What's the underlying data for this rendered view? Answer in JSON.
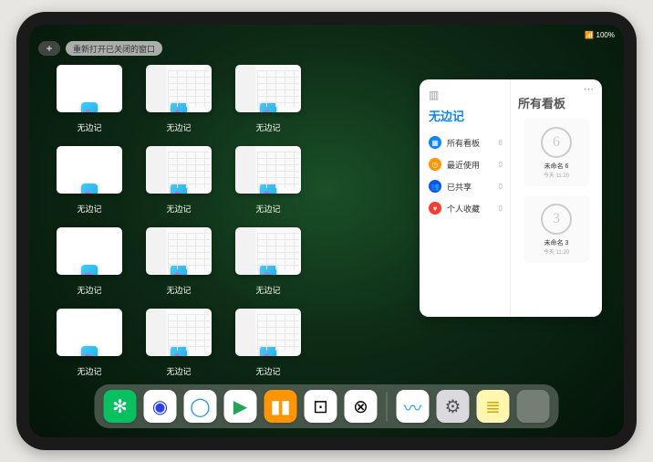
{
  "status": {
    "time": "",
    "battery": "100%"
  },
  "topbar": {
    "plus": "+",
    "reopen_label": "重新打开已关闭的窗口"
  },
  "app": {
    "name": "无边记"
  },
  "windows": [
    {
      "label": "无边记",
      "variant": "blank"
    },
    {
      "label": "无边记",
      "variant": "detail"
    },
    {
      "label": "无边记",
      "variant": "detail"
    },
    {
      "label": "无边记",
      "variant": "blank"
    },
    {
      "label": "无边记",
      "variant": "detail"
    },
    {
      "label": "无边记",
      "variant": "detail"
    },
    {
      "label": "无边记",
      "variant": "blank"
    },
    {
      "label": "无边记",
      "variant": "detail"
    },
    {
      "label": "无边记",
      "variant": "detail"
    },
    {
      "label": "无边记",
      "variant": "blank"
    },
    {
      "label": "无边记",
      "variant": "detail"
    },
    {
      "label": "无边记",
      "variant": "detail"
    }
  ],
  "panel": {
    "left_title": "无边记",
    "right_title": "所有看板",
    "menu": [
      {
        "icon": "grid",
        "color": "#0a84ff",
        "label": "所有看板",
        "count": "8"
      },
      {
        "icon": "clock",
        "color": "#ff9500",
        "label": "最近使用",
        "count": "0"
      },
      {
        "icon": "people",
        "color": "#0a50ff",
        "label": "已共享",
        "count": "0"
      },
      {
        "icon": "heart",
        "color": "#ff3b30",
        "label": "个人收藏",
        "count": "0"
      }
    ],
    "boards": [
      {
        "sketch": "6",
        "name": "未命名 6",
        "time": "今天 11:20"
      },
      {
        "sketch": "3",
        "name": "未命名 3",
        "time": "今天 11:20"
      }
    ]
  },
  "dock": {
    "apps": [
      {
        "name": "wechat",
        "bg": "#07c160",
        "glyph": "✻"
      },
      {
        "name": "quark",
        "bg": "#ffffff",
        "glyph": "◉",
        "fg": "#2a3cff"
      },
      {
        "name": "qqbrowser",
        "bg": "#ffffff",
        "glyph": "◯",
        "fg": "#1e90ff"
      },
      {
        "name": "playstore",
        "bg": "#ffffff",
        "glyph": "▶",
        "fg": "#23a559"
      },
      {
        "name": "books",
        "bg": "#ff9500",
        "glyph": "▮▮",
        "fg": "#fff"
      },
      {
        "name": "dice",
        "bg": "#ffffff",
        "glyph": "⊡",
        "fg": "#000"
      },
      {
        "name": "connect",
        "bg": "#ffffff",
        "glyph": "⊗",
        "fg": "#000"
      }
    ],
    "recent": [
      {
        "name": "freeform",
        "bg": "#ffffff",
        "glyph": "〰",
        "fg": "#1ea8d8"
      },
      {
        "name": "settings",
        "bg": "#d9d9de",
        "glyph": "⚙",
        "fg": "#555"
      },
      {
        "name": "notes",
        "bg": "#fff6b0",
        "glyph": "≣",
        "fg": "#d6a400"
      }
    ]
  }
}
